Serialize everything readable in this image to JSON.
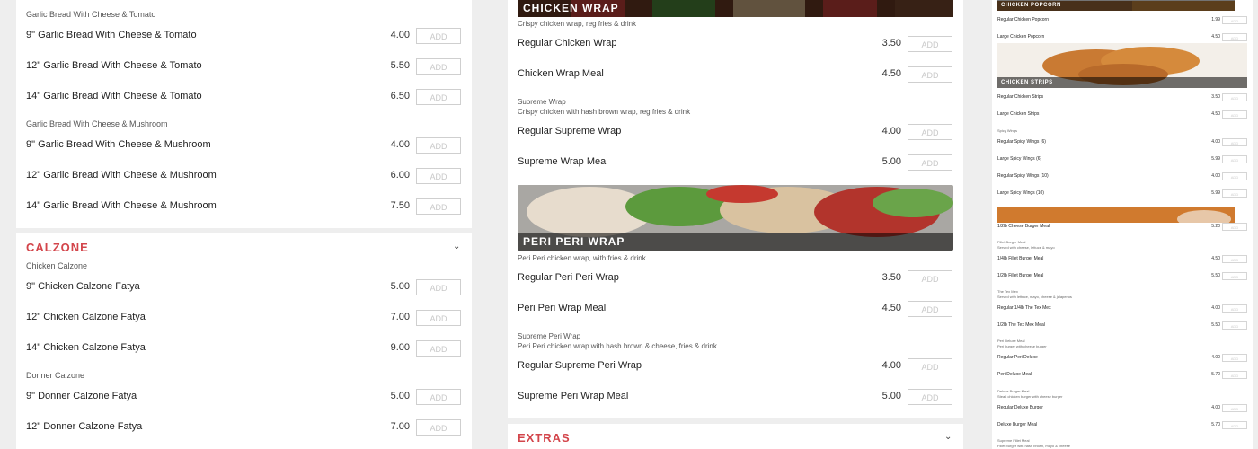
{
  "left": {
    "garlic_tomato": {
      "subheading": "Garlic Bread With Cheese & Tomato",
      "items": [
        {
          "name": "9\" Garlic Bread With Cheese & Tomato",
          "price": "4.00",
          "add": "ADD"
        },
        {
          "name": "12\" Garlic Bread With Cheese & Tomato",
          "price": "5.50",
          "add": "ADD"
        },
        {
          "name": "14\" Garlic Bread With Cheese & Tomato",
          "price": "6.50",
          "add": "ADD"
        }
      ]
    },
    "garlic_mushroom": {
      "subheading": "Garlic Bread With Cheese & Mushroom",
      "items": [
        {
          "name": "9\" Garlic Bread With Cheese & Mushroom",
          "price": "4.00",
          "add": "ADD"
        },
        {
          "name": "12\" Garlic Bread With Cheese & Mushroom",
          "price": "6.00",
          "add": "ADD"
        },
        {
          "name": "14\" Garlic Bread With Cheese & Mushroom",
          "price": "7.50",
          "add": "ADD"
        }
      ]
    },
    "calzone": {
      "title": "CALZONE",
      "chicken_sub": "Chicken Calzone",
      "chicken_items": [
        {
          "name": "9\" Chicken Calzone Fatya",
          "price": "5.00",
          "add": "ADD"
        },
        {
          "name": "12\" Chicken Calzone Fatya",
          "price": "7.00",
          "add": "ADD"
        },
        {
          "name": "14\" Chicken Calzone Fatya",
          "price": "9.00",
          "add": "ADD"
        }
      ],
      "donner_sub": "Donner Calzone",
      "donner_items": [
        {
          "name": "9\" Donner Calzone Fatya",
          "price": "5.00",
          "add": "ADD"
        },
        {
          "name": "12\" Donner Calzone Fatya",
          "price": "7.00",
          "add": "ADD"
        }
      ]
    }
  },
  "middle": {
    "chicken_wrap": {
      "banner": "CHICKEN WRAP",
      "desc": "Crispy chicken wrap, reg fries & drink",
      "items": [
        {
          "name": "Regular Chicken Wrap",
          "price": "3.50",
          "add": "ADD"
        },
        {
          "name": "Chicken Wrap Meal",
          "price": "4.50",
          "add": "ADD"
        }
      ]
    },
    "supreme_wrap": {
      "title": "Supreme Wrap",
      "desc": "Crispy chicken with hash brown wrap, reg fries & drink",
      "items": [
        {
          "name": "Regular Supreme Wrap",
          "price": "4.00",
          "add": "ADD"
        },
        {
          "name": "Supreme Wrap Meal",
          "price": "5.00",
          "add": "ADD"
        }
      ]
    },
    "peri_wrap": {
      "banner": "PERI PERI WRAP",
      "desc": "Peri Peri chicken wrap, with fries & drink",
      "items": [
        {
          "name": "Regular Peri Peri Wrap",
          "price": "3.50",
          "add": "ADD"
        },
        {
          "name": "Peri Peri Wrap Meal",
          "price": "4.50",
          "add": "ADD"
        }
      ]
    },
    "supreme_peri": {
      "title": "Supreme Peri Wrap",
      "desc": "Peri Peri chicken wrap with hash brown & cheese, fries & drink",
      "items": [
        {
          "name": "Regular Supreme Peri Wrap",
          "price": "4.00",
          "add": "ADD"
        },
        {
          "name": "Supreme Peri Wrap Meal",
          "price": "5.00",
          "add": "ADD"
        }
      ]
    },
    "extras": {
      "title": "EXTRAS"
    }
  },
  "right": {
    "popcorn": {
      "banner": "CHICKEN POPCORN",
      "items": [
        {
          "name": "Regular Chicken Popcorn",
          "price": "1.99",
          "add": "ADD"
        },
        {
          "name": "Large Chicken Popcorn",
          "price": "4.50",
          "add": "ADD"
        }
      ]
    },
    "strips": {
      "banner": "CHICKEN STRIPS",
      "items": [
        {
          "name": "Regular Chicken Strips",
          "price": "3.50",
          "add": "ADD"
        },
        {
          "name": "Large Chicken Strips",
          "price": "4.50",
          "add": "ADD"
        }
      ]
    },
    "wings": {
      "subheading": "Spicy Wings",
      "items": [
        {
          "name": "Regular Spicy Wings (6)",
          "price": "4.00",
          "add": "ADD"
        },
        {
          "name": "Large Spicy Wings (6)",
          "price": "5.99",
          "add": "ADD"
        },
        {
          "name": "Regular Spicy Wings (10)",
          "price": "4.00",
          "add": "ADD"
        },
        {
          "name": "Large Spicy Wings (10)",
          "price": "5.99",
          "add": "ADD"
        }
      ]
    },
    "burgers": {
      "top_item": {
        "name": "1/2lb Cheese Burger Meal",
        "price": "5.20",
        "add": "ADD"
      },
      "fillet_sub": "Fillet Burger Meal",
      "fillet_desc": "Served with cheese, lettuce & mayo",
      "fillet_items": [
        {
          "name": "1/4lb Fillet Burger Meal",
          "price": "4.50",
          "add": "ADD"
        },
        {
          "name": "1/2lb Fillet Burger Meal",
          "price": "5.50",
          "add": "ADD"
        }
      ],
      "texmex_sub": "The Tex Mex",
      "texmex_desc": "Served with lettuce, mayo, cheese & jalapenos",
      "texmex_items": [
        {
          "name": "Regular 1/4lb The Tex Mex",
          "price": "4.00",
          "add": "ADD"
        },
        {
          "name": "1/2lb The Tex Mex Meal",
          "price": "5.50",
          "add": "ADD"
        }
      ],
      "peri_sub": "Peri Deluxe Meal",
      "peri_desc": "Peri burger with cheese burger",
      "peri_items": [
        {
          "name": "Regular Peri Deluxe",
          "price": "4.00",
          "add": "ADD"
        },
        {
          "name": "Peri Deluxe Meal",
          "price": "5.70",
          "add": "ADD"
        }
      ],
      "deluxe_sub": "Deluxe Burger Meal",
      "deluxe_desc": "Steak chicken burger with cheese burger",
      "deluxe_items": [
        {
          "name": "Regular Deluxe Burger",
          "price": "4.00",
          "add": "ADD"
        },
        {
          "name": "Deluxe Burger Meal",
          "price": "5.70",
          "add": "ADD"
        }
      ],
      "supreme_sub": "Supreme Fillet Meal",
      "supreme_desc": "Fillet burger with hash brown, mayo & cheese"
    }
  },
  "colors": {
    "accent": "#d3454b",
    "add_text": "#c8c8c8",
    "border": "#cfcfcf"
  }
}
